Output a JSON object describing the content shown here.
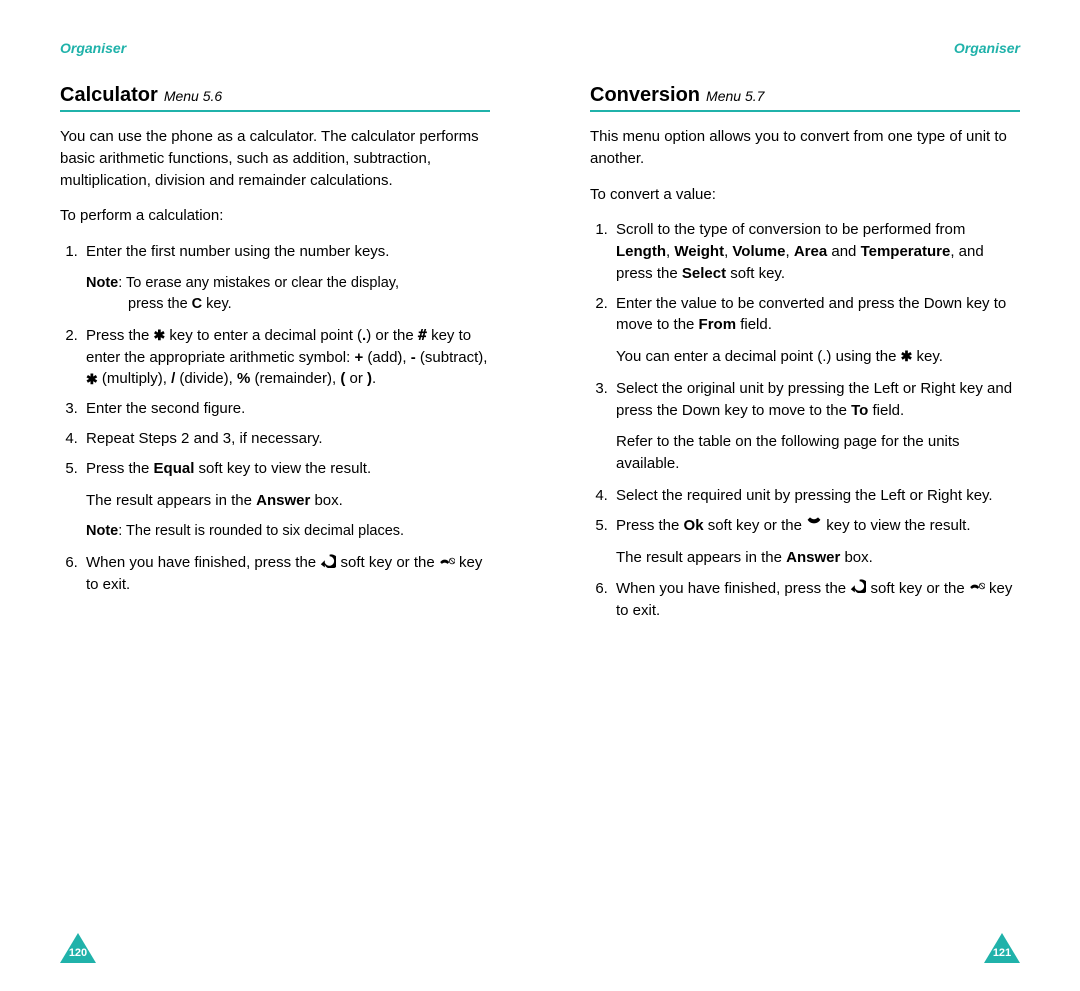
{
  "left": {
    "header": "Organiser",
    "title": "Calculator",
    "menuRef": "Menu 5.6",
    "intro": "You can use the phone as a calculator. The calculator performs basic arithmetic functions, such as addition, subtraction, multiplication, division and remainder calculations.",
    "lead": "To perform a calculation:",
    "step1": "Enter the first number using the number keys.",
    "step1_note_label": "Note",
    "step1_note_a": ": To erase any mistakes or clear the display,",
    "step1_note_b": "press the ",
    "step1_note_b_bold": "C",
    "step1_note_b2": " key.",
    "step2_a": "Press the ",
    "step2_b": " key to enter a decimal point (",
    "step2_dot": ".",
    "step2_c": ") or the ",
    "step2_d": " key to enter the appropriate arithmetic symbol: ",
    "step2_add": "+",
    "step2_add_txt": " (add), ",
    "step2_sub": "-",
    "step2_sub_txt": " (subtract), ",
    "step2_mul_txt": " (multiply), ",
    "step2_div": "/",
    "step2_div_txt": " (divide), ",
    "step2_pct": "%",
    "step2_pct_txt": " (remainder), ",
    "step2_lp": "(",
    "step2_or": " or ",
    "step2_rp": ")",
    "step2_end": ".",
    "step3": "Enter the second figure.",
    "step4": "Repeat Steps 2 and 3, if necessary.",
    "step5_a": "Press the ",
    "step5_b": "Equal",
    "step5_c": " soft key to view the result.",
    "step5_p2_a": "The result appears in the ",
    "step5_p2_b": "Answer",
    "step5_p2_c": " box.",
    "step5_note_label": "Note",
    "step5_note": ": The result is rounded to six decimal places.",
    "step6_a": "When you have finished, press the ",
    "step6_b": " soft key or the ",
    "step6_c": " key to exit.",
    "pageNum": "120"
  },
  "right": {
    "header": "Organiser",
    "title": "Conversion",
    "menuRef": "Menu 5.7",
    "intro": "This menu option allows you to convert from one type of unit to another.",
    "lead": "To convert a value:",
    "step1_a": "Scroll to the type of conversion to be performed from ",
    "step1_b1": "Length",
    "step1_s1": ", ",
    "step1_b2": "Weight",
    "step1_s2": ", ",
    "step1_b3": "Volume",
    "step1_s3": ", ",
    "step1_b4": "Area",
    "step1_s4": " and ",
    "step1_b5": "Temperature",
    "step1_c": ", and press the ",
    "step1_b6": "Select",
    "step1_d": " soft key.",
    "step2_a": "Enter the value to be converted and press the Down key to move to the ",
    "step2_b": "From",
    "step2_c": " field.",
    "step2_p2_a": "You can enter a decimal point (.) using the ",
    "step2_p2_b": " key.",
    "step3_a": "Select the original unit by pressing the Left or Right key and press the Down key to move to the ",
    "step3_b": "To",
    "step3_c": " field.",
    "step3_p2": "Refer to the table on the following page for the units available.",
    "step4": "Select the required unit by pressing the Left or Right key.",
    "step5_a": "Press the ",
    "step5_b": "Ok",
    "step5_c": " soft key or the ",
    "step5_d": " key to view the result.",
    "step5_p2_a": "The result appears in the ",
    "step5_p2_b": "Answer",
    "step5_p2_c": " box.",
    "step6_a": "When you have finished, press the ",
    "step6_b": " soft key or the ",
    "step6_c": " key to exit.",
    "pageNum": "121"
  },
  "colors": {
    "accent": "#20b2aa"
  }
}
